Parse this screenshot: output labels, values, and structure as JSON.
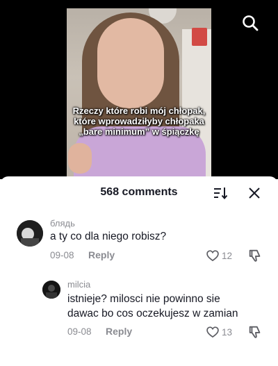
{
  "video": {
    "caption_line1": "Rzeczy które robi mój chłopak,",
    "caption_line2": "które wprowadziłyby chłopaka",
    "caption_line3": "„bare minimum” w śpiączkę",
    "search_icon": "search-icon"
  },
  "comments_panel": {
    "title": "568 comments",
    "sort_icon": "sort-icon",
    "close_icon": "close-icon"
  },
  "comments": [
    {
      "username": "блядь",
      "text": "a ty co dla niego robisz?",
      "date": "09-08",
      "reply_label": "Reply",
      "likes": "12"
    },
    {
      "username": "milcia",
      "text_line1": "istnieje? milosci nie powinno sie",
      "text_line2": "dawac bo cos oczekujesz w zamian",
      "date": "09-08",
      "reply_label": "Reply",
      "likes": "13"
    }
  ]
}
